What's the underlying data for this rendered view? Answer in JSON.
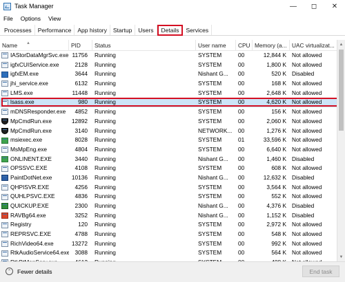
{
  "window": {
    "title": "Task Manager"
  },
  "menu": [
    "File",
    "Options",
    "View"
  ],
  "tabs": [
    "Processes",
    "Performance",
    "App history",
    "Startup",
    "Users",
    "Details",
    "Services"
  ],
  "active_tab": "Details",
  "columns": [
    "Name",
    "PID",
    "Status",
    "User name",
    "CPU",
    "Memory (a...",
    "UAC virtualizat..."
  ],
  "rows": [
    {
      "name": "IAStorDataMgrSvc.exe",
      "pid": "11756",
      "status": "Running",
      "user": "SYSTEM",
      "cpu": "00",
      "mem": "12,844 K",
      "uac": "Not allowed",
      "icon": "app"
    },
    {
      "name": "igfxCUIService.exe",
      "pid": "2128",
      "status": "Running",
      "user": "SYSTEM",
      "cpu": "00",
      "mem": "1,800 K",
      "uac": "Not allowed",
      "icon": "app"
    },
    {
      "name": "igfxEM.exe",
      "pid": "3644",
      "status": "Running",
      "user": "Nishant G...",
      "cpu": "00",
      "mem": "520 K",
      "uac": "Disabled",
      "icon": "blue"
    },
    {
      "name": "jhi_service.exe",
      "pid": "6132",
      "status": "Running",
      "user": "SYSTEM",
      "cpu": "00",
      "mem": "168 K",
      "uac": "Not allowed",
      "icon": "app"
    },
    {
      "name": "LMS.exe",
      "pid": "11448",
      "status": "Running",
      "user": "SYSTEM",
      "cpu": "00",
      "mem": "2,648 K",
      "uac": "Not allowed",
      "icon": "app"
    },
    {
      "name": "lsass.exe",
      "pid": "980",
      "status": "Running",
      "user": "SYSTEM",
      "cpu": "00",
      "mem": "4,620 K",
      "uac": "Not allowed",
      "icon": "app",
      "selected": true
    },
    {
      "name": "mDNSResponder.exe",
      "pid": "4852",
      "status": "Running",
      "user": "SYSTEM",
      "cpu": "00",
      "mem": "156 K",
      "uac": "Not allowed",
      "icon": "app"
    },
    {
      "name": "MpCmdRun.exe",
      "pid": "12892",
      "status": "Running",
      "user": "SYSTEM",
      "cpu": "00",
      "mem": "2,060 K",
      "uac": "Not allowed",
      "icon": "shield"
    },
    {
      "name": "MpCmdRun.exe",
      "pid": "3140",
      "status": "Running",
      "user": "NETWORK...",
      "cpu": "00",
      "mem": "1,276 K",
      "uac": "Not allowed",
      "icon": "shield"
    },
    {
      "name": "msiexec.exe",
      "pid": "8028",
      "status": "Running",
      "user": "SYSTEM",
      "cpu": "01",
      "mem": "33,596 K",
      "uac": "Not allowed",
      "icon": "green"
    },
    {
      "name": "MsMpEng.exe",
      "pid": "4804",
      "status": "Running",
      "user": "SYSTEM",
      "cpu": "00",
      "mem": "6,640 K",
      "uac": "Not allowed",
      "icon": "app"
    },
    {
      "name": "ONLINENT.EXE",
      "pid": "3440",
      "status": "Running",
      "user": "Nishant G...",
      "cpu": "00",
      "mem": "1,460 K",
      "uac": "Disabled",
      "icon": "green"
    },
    {
      "name": "OPSSVC.EXE",
      "pid": "4108",
      "status": "Running",
      "user": "SYSTEM",
      "cpu": "00",
      "mem": "608 K",
      "uac": "Not allowed",
      "icon": "app"
    },
    {
      "name": "PaintDotNet.exe",
      "pid": "10136",
      "status": "Running",
      "user": "Nishant G...",
      "cpu": "00",
      "mem": "12,632 K",
      "uac": "Disabled",
      "icon": "paint"
    },
    {
      "name": "QHPISVR.EXE",
      "pid": "4256",
      "status": "Running",
      "user": "SYSTEM",
      "cpu": "00",
      "mem": "3,564 K",
      "uac": "Not allowed",
      "icon": "app"
    },
    {
      "name": "QUHLPSVC.EXE",
      "pid": "4836",
      "status": "Running",
      "user": "SYSTEM",
      "cpu": "00",
      "mem": "552 K",
      "uac": "Not allowed",
      "icon": "app"
    },
    {
      "name": "QUICKUP.EXE",
      "pid": "2300",
      "status": "Running",
      "user": "Nishant G...",
      "cpu": "00",
      "mem": "4,376 K",
      "uac": "Disabled",
      "icon": "quick"
    },
    {
      "name": "RAVBg64.exe",
      "pid": "3252",
      "status": "Running",
      "user": "Nishant G...",
      "cpu": "00",
      "mem": "1,152 K",
      "uac": "Disabled",
      "icon": "red"
    },
    {
      "name": "Registry",
      "pid": "120",
      "status": "Running",
      "user": "SYSTEM",
      "cpu": "00",
      "mem": "2,972 K",
      "uac": "Not allowed",
      "icon": "app"
    },
    {
      "name": "REPRSVC.EXE",
      "pid": "4788",
      "status": "Running",
      "user": "SYSTEM",
      "cpu": "00",
      "mem": "548 K",
      "uac": "Not allowed",
      "icon": "app"
    },
    {
      "name": "RichVideo64.exe",
      "pid": "13272",
      "status": "Running",
      "user": "SYSTEM",
      "cpu": "00",
      "mem": "992 K",
      "uac": "Not allowed",
      "icon": "app"
    },
    {
      "name": "RtkAudioService64.exe",
      "pid": "3088",
      "status": "Running",
      "user": "SYSTEM",
      "cpu": "00",
      "mem": "564 K",
      "uac": "Not allowed",
      "icon": "app"
    },
    {
      "name": "RtkBtManServ.exe",
      "pid": "4612",
      "status": "Running",
      "user": "SYSTEM",
      "cpu": "00",
      "mem": "488 K",
      "uac": "Not allowed",
      "icon": "app"
    }
  ],
  "footer": {
    "fewer_details": "Fewer details",
    "end_task": "End task"
  }
}
